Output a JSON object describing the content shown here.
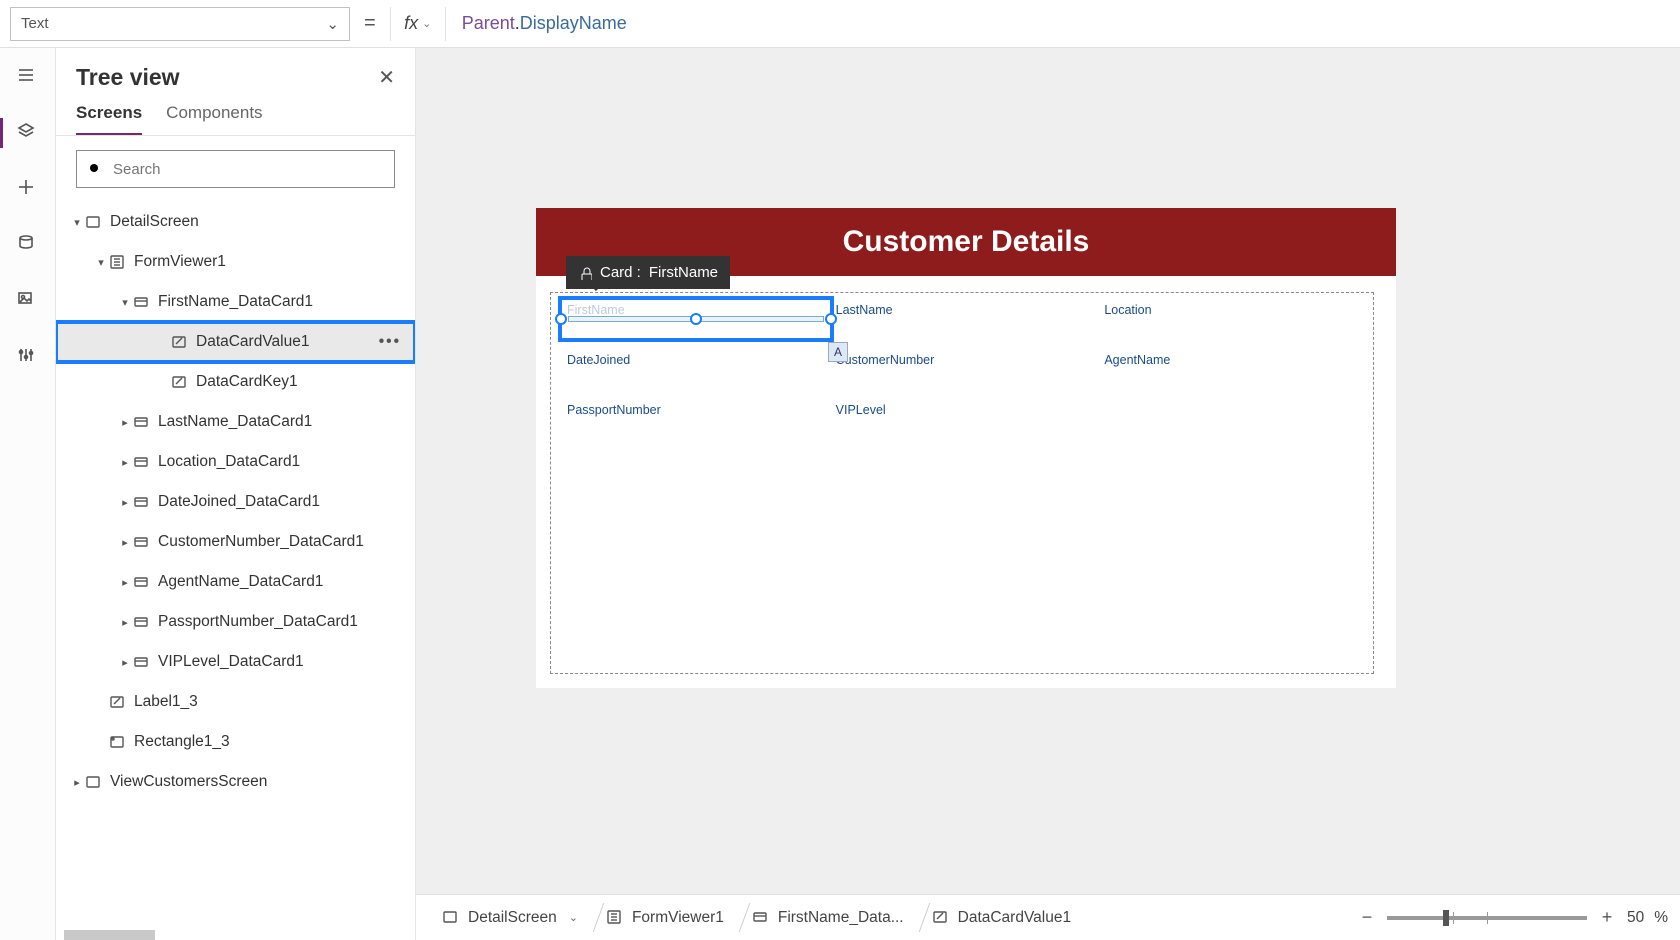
{
  "prop_selector": {
    "value": "Text"
  },
  "formula": {
    "token_parent": "Parent",
    "token_dot": ".",
    "token_prop": "DisplayName"
  },
  "tree": {
    "title": "Tree view",
    "tabs": {
      "screens": "Screens",
      "components": "Components"
    },
    "search_placeholder": "Search",
    "items": [
      {
        "indent": 0,
        "chev": "v",
        "icon": "screen",
        "label": "DetailScreen"
      },
      {
        "indent": 1,
        "chev": "v",
        "icon": "form",
        "label": "FormViewer1"
      },
      {
        "indent": 2,
        "chev": "v",
        "icon": "card",
        "label": "FirstName_DataCard1"
      },
      {
        "indent": 3,
        "chev": "",
        "icon": "edit",
        "label": "DataCardValue1",
        "selected": true
      },
      {
        "indent": 3,
        "chev": "",
        "icon": "edit",
        "label": "DataCardKey1"
      },
      {
        "indent": 2,
        "chev": ">",
        "icon": "card",
        "label": "LastName_DataCard1"
      },
      {
        "indent": 2,
        "chev": ">",
        "icon": "card",
        "label": "Location_DataCard1"
      },
      {
        "indent": 2,
        "chev": ">",
        "icon": "card",
        "label": "DateJoined_DataCard1"
      },
      {
        "indent": 2,
        "chev": ">",
        "icon": "card",
        "label": "CustomerNumber_DataCard1"
      },
      {
        "indent": 2,
        "chev": ">",
        "icon": "card",
        "label": "AgentName_DataCard1"
      },
      {
        "indent": 2,
        "chev": ">",
        "icon": "card",
        "label": "PassportNumber_DataCard1"
      },
      {
        "indent": 2,
        "chev": ">",
        "icon": "card",
        "label": "VIPLevel_DataCard1"
      },
      {
        "indent": 1,
        "chev": "",
        "icon": "edit",
        "label": "Label1_3"
      },
      {
        "indent": 1,
        "chev": "",
        "icon": "rect",
        "label": "Rectangle1_3"
      },
      {
        "indent": 0,
        "chev": ">",
        "icon": "screen",
        "label": "ViewCustomersScreen"
      }
    ]
  },
  "canvas": {
    "heading": "Customer Details",
    "tooltip_prefix": "Card :",
    "tooltip_field": "FirstName",
    "badge": "A",
    "fields": [
      "FirstName",
      "LastName",
      "Location",
      "DateJoined",
      "CustomerNumber",
      "AgentName",
      "PassportNumber",
      "VIPLevel"
    ]
  },
  "breadcrumb": [
    {
      "icon": "screen",
      "label": "DetailScreen",
      "chev": true
    },
    {
      "icon": "form",
      "label": "FormViewer1"
    },
    {
      "icon": "card",
      "label": "FirstName_Data..."
    },
    {
      "icon": "edit",
      "label": "DataCardValue1"
    }
  ],
  "zoom": {
    "value_label": "50",
    "unit": "%"
  }
}
